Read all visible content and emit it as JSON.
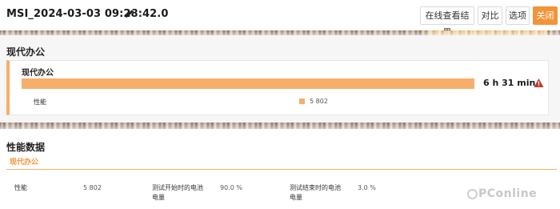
{
  "header": {
    "title": "MSI_2024-03-03 09:28:42.0",
    "buttons": {
      "view_online": "在线查看结果",
      "compare": "对比",
      "options": "选项",
      "close": "关闭"
    }
  },
  "summary": {
    "section_title": "现代办公",
    "card": {
      "title": "现代办公",
      "duration": "6 h 31 min",
      "progress": 1.0,
      "metric_label": "性能",
      "metric_value": "5 802"
    }
  },
  "performance": {
    "section_title": "性能数据",
    "tab_label": "现代办公",
    "rows": [
      {
        "label": "性能",
        "value": "5 802"
      },
      {
        "label": "测试开始时的电池电量",
        "value": "90.0 %"
      },
      {
        "label": "测试结束时的电池电量",
        "value": "3.0 %"
      }
    ]
  },
  "watermark": "PConline",
  "colors": {
    "accent": "#f39437",
    "bar": "#f7ae6a",
    "section_bg": "#f6f6f6"
  }
}
